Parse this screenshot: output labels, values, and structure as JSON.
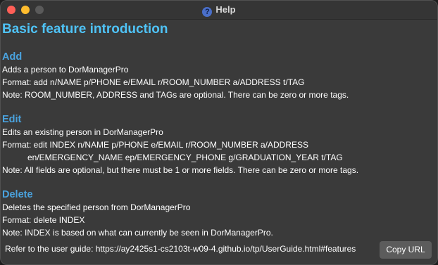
{
  "window": {
    "title": "Help",
    "icon": "question-mark-icon"
  },
  "content": {
    "main_title": "Basic feature introduction",
    "sections": [
      {
        "title": "Add",
        "lines": [
          "Adds a person to DorManagerPro",
          "Format: add n/NAME p/PHONE e/EMAIL r/ROOM_NUMBER a/ADDRESS t/TAG",
          "Note: ROOM_NUMBER, ADDRESS and TAGs are optional. There can be zero or more tags."
        ]
      },
      {
        "title": "Edit",
        "lines": [
          "Edits an existing person in DorManagerPro",
          "Format: edit INDEX n/NAME p/PHONE e/EMAIL r/ROOM_NUMBER a/ADDRESS",
          "en/EMERGENCY_NAME ep/EMERGENCY_PHONE g/GRADUATION_YEAR t/TAG",
          "Note: All fields are optional, but there must be 1 or more fields. There can be zero or more tags."
        ]
      },
      {
        "title": "Delete",
        "lines": [
          "Deletes the specified person from DorManagerPro",
          "Format: delete INDEX",
          "Note: INDEX is based on what can currently be seen in DorManagerPro."
        ]
      }
    ]
  },
  "footer": {
    "guide_text": "Refer to the user guide: https://ay2425s1-cs2103t-w09-4.github.io/tp/UserGuide.html#features",
    "copy_button": "Copy URL"
  },
  "colors": {
    "background": "#3a3a3a",
    "heading": "#4fc3f7",
    "section_heading": "#4aa3df",
    "button": "#5c5c5c"
  }
}
